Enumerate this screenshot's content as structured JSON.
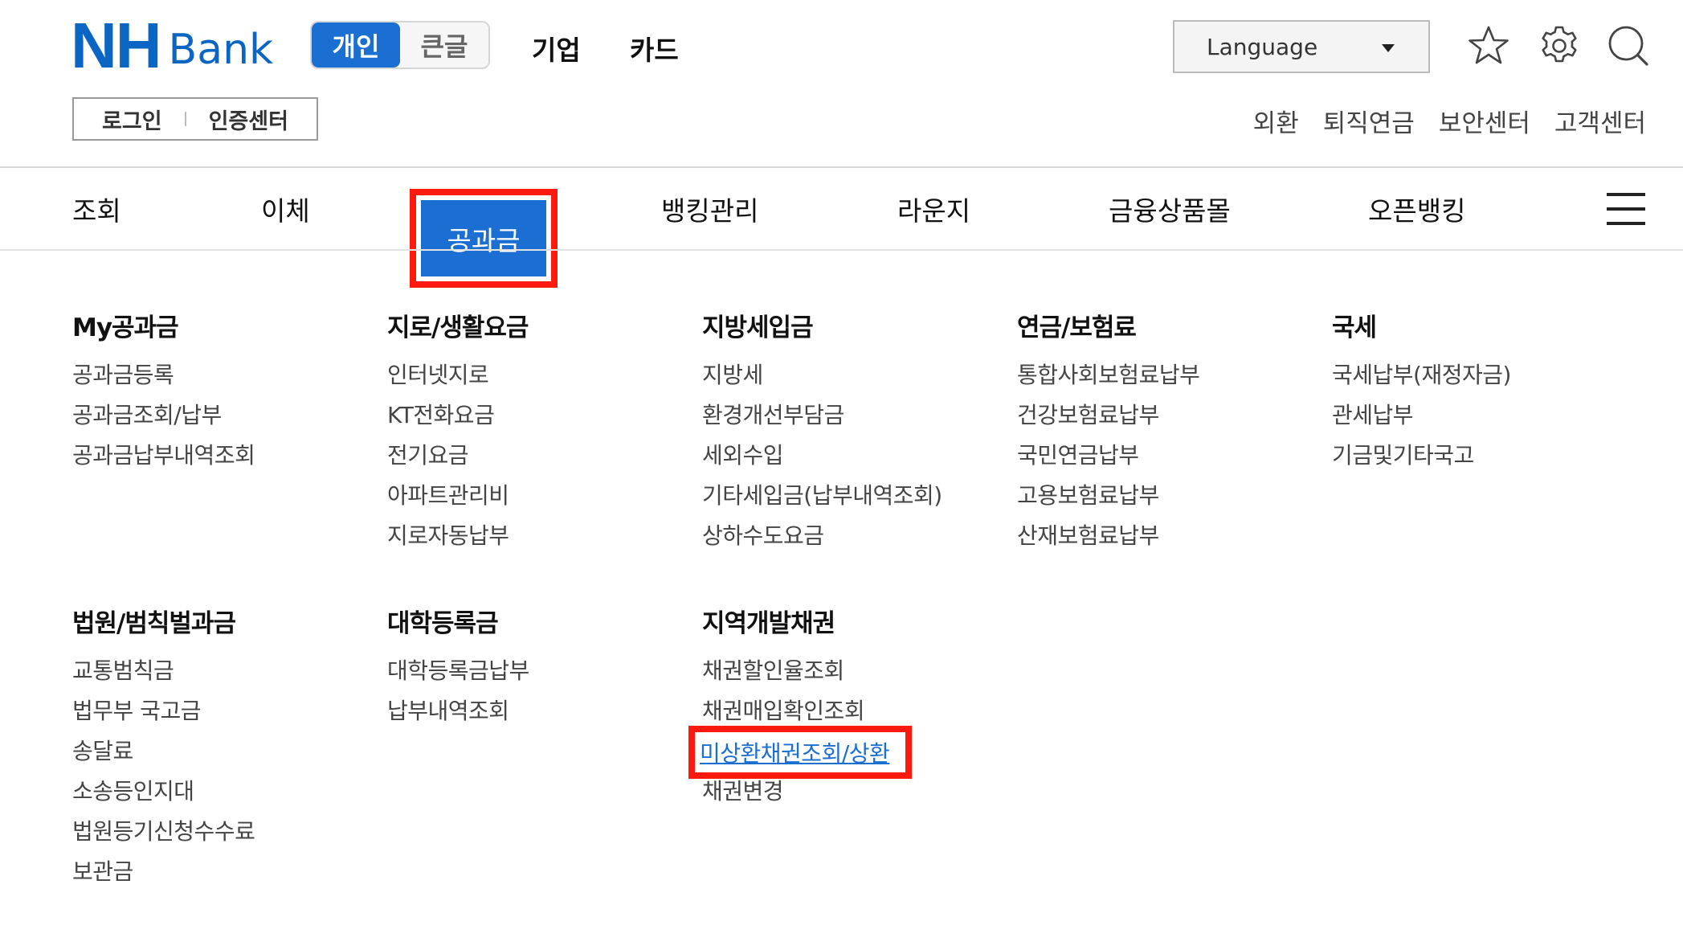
{
  "header": {
    "logo": {
      "nh": "NH",
      "bank": "Bank"
    },
    "modes": [
      "개인",
      "큰글"
    ],
    "top_links": [
      "기업",
      "카드"
    ],
    "language": {
      "label": "Language"
    },
    "icons": [
      "star-icon",
      "gear-icon",
      "search-icon"
    ],
    "login": [
      "로그인",
      "인증센터"
    ],
    "util_links": [
      "외환",
      "퇴직연금",
      "보안센터",
      "고객센터"
    ]
  },
  "nav": {
    "items": [
      "조회",
      "이체",
      "공과금",
      "뱅킹관리",
      "라운지",
      "금융상품몰",
      "오픈뱅킹"
    ],
    "active_index": 2,
    "menu_icon": "hamburger-icon"
  },
  "menu": {
    "columns": [
      {
        "title": "My공과금",
        "items": [
          "공과금등록",
          "공과금조회/납부",
          "공과금납부내역조회"
        ]
      },
      {
        "title": "지로/생활요금",
        "items": [
          "인터넷지로",
          "KT전화요금",
          "전기요금",
          "아파트관리비",
          "지로자동납부"
        ]
      },
      {
        "title": "지방세입금",
        "items": [
          "지방세",
          "환경개선부담금",
          "세외수입",
          "기타세입금(납부내역조회)",
          "상하수도요금"
        ]
      },
      {
        "title": "연금/보험료",
        "items": [
          "통합사회보험료납부",
          "건강보험료납부",
          "국민연금납부",
          "고용보험료납부",
          "산재보험료납부"
        ]
      },
      {
        "title": "국세",
        "items": [
          "국세납부(재정자금)",
          "관세납부",
          "기금및기타국고"
        ]
      },
      {
        "title": "법원/범칙벌과금",
        "items": [
          "교통범칙금",
          "법무부 국고금",
          "송달료",
          "소송등인지대",
          "법원등기신청수수료",
          "보관금"
        ]
      },
      {
        "title": "대학등록금",
        "items": [
          "대학등록금납부",
          "납부내역조회"
        ]
      },
      {
        "title": "지역개발채권",
        "items": [
          "채권할인율조회",
          "채권매입확인조회",
          "미상환채권조회/상환",
          "채권변경"
        ]
      }
    ],
    "highlighted": {
      "column": 7,
      "item": 2
    }
  },
  "colors": {
    "brand": "#0b66c3",
    "accent": "#1b6fd3",
    "highlight_border": "#ff1a0f"
  }
}
